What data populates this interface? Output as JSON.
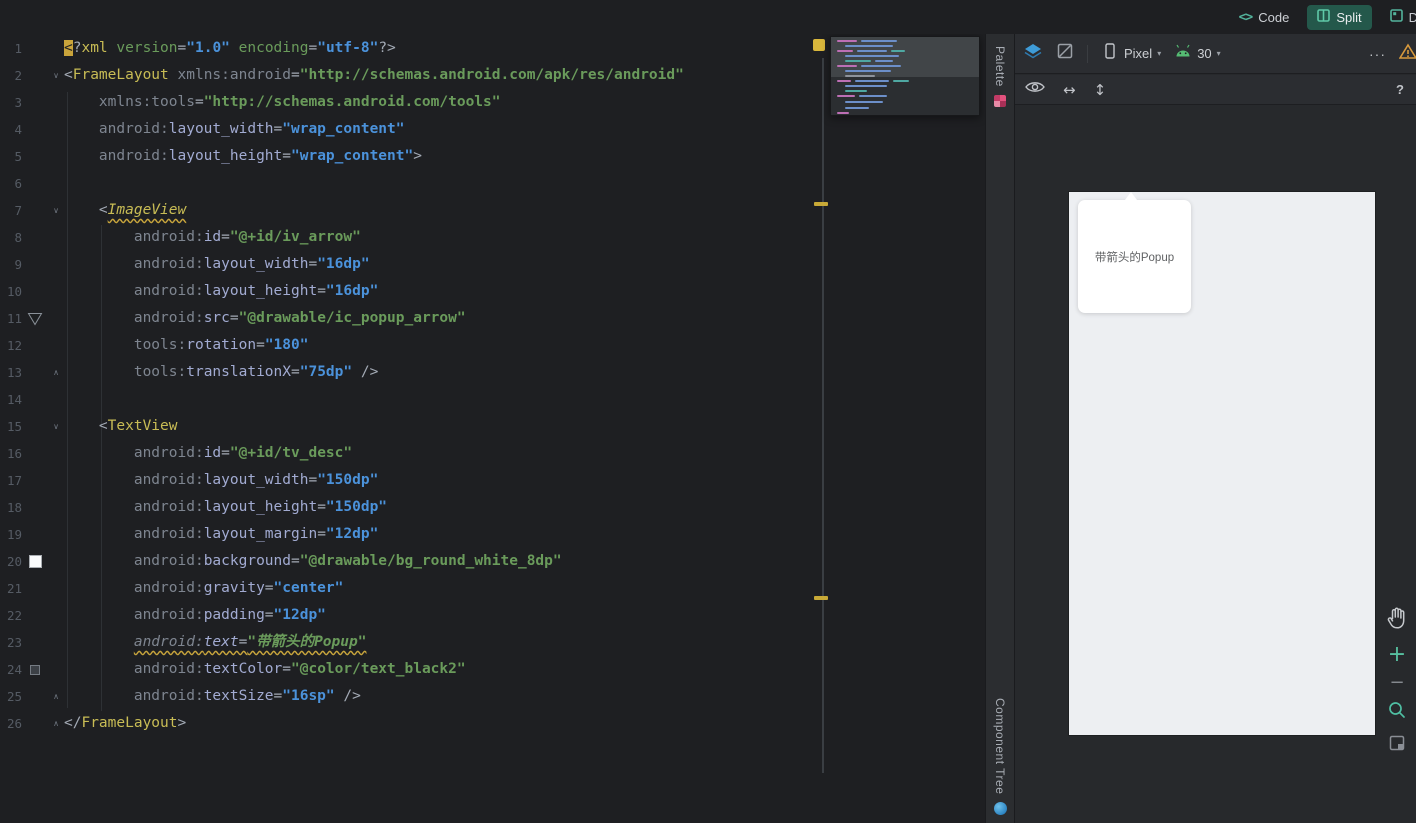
{
  "colors": {
    "editor_bg": "#1E1F22",
    "panel_bg": "#2B2D31",
    "canvas_bg": "#27292C",
    "active_tab_bg": "#24584B",
    "accent_teal": "#5FC9A8",
    "tag_yellow": "#C8BC55",
    "attr_lavender": "#A2ABD2",
    "value_blue": "#4B92DB",
    "string_green": "#6A9B5B",
    "warning_yellow": "#D9B73C",
    "device_screen_bg": "#EDEFF2",
    "popup_card_bg": "#FFFFFF",
    "palette_icon_pink": "#E4527E",
    "component_tree_icon_blue": "#3A9BD9"
  },
  "topbar": {
    "tabs": [
      {
        "id": "code",
        "label": "Code"
      },
      {
        "id": "split",
        "label": "Split",
        "active": true
      },
      {
        "id": "design",
        "label": "D"
      }
    ]
  },
  "tool_strips": {
    "palette": "Palette",
    "component_tree": "Component Tree"
  },
  "design": {
    "device_label": "Pixel",
    "api_label": "30",
    "more_label": "···",
    "help_label": "?",
    "popup_text": "带箭头的Popup"
  },
  "editor": {
    "lines": [
      {
        "n": 1,
        "t": [
          [
            "hl",
            "<"
          ],
          [
            "p",
            "?"
          ],
          [
            "tag",
            "xml"
          ],
          [
            "p",
            " "
          ],
          [
            "attrg",
            "version"
          ],
          [
            "p",
            "="
          ],
          [
            "vb",
            "\"1.0\""
          ],
          [
            "p",
            " "
          ],
          [
            "attrg",
            "encoding"
          ],
          [
            "p",
            "="
          ],
          [
            "vb",
            "\"utf-8\""
          ],
          [
            "p",
            "?>"
          ]
        ]
      },
      {
        "n": 2,
        "fold": "down",
        "t": [
          [
            "p",
            "<"
          ],
          [
            "tag",
            "FrameLayout"
          ],
          [
            "p",
            " "
          ],
          [
            "ns",
            "xmlns:android"
          ],
          [
            "p",
            "="
          ],
          [
            "vg",
            "\"http://schemas.android.com/apk/res/android\""
          ]
        ]
      },
      {
        "n": 3,
        "ind": 4,
        "t": [
          [
            "ns",
            "xmlns:tools"
          ],
          [
            "p",
            "="
          ],
          [
            "vg",
            "\"http://schemas.android.com/tools\""
          ]
        ]
      },
      {
        "n": 4,
        "ind": 4,
        "t": [
          [
            "ns",
            "android:"
          ],
          [
            "attr",
            "layout_width"
          ],
          [
            "p",
            "="
          ],
          [
            "vb",
            "\"wrap_content\""
          ]
        ]
      },
      {
        "n": 5,
        "ind": 4,
        "t": [
          [
            "ns",
            "android:"
          ],
          [
            "attr",
            "layout_height"
          ],
          [
            "p",
            "="
          ],
          [
            "vb",
            "\"wrap_content\""
          ],
          [
            "p",
            ">"
          ]
        ]
      },
      {
        "n": 6,
        "t": []
      },
      {
        "n": 7,
        "ind": 4,
        "fold": "down",
        "t": [
          [
            "p",
            "<"
          ],
          [
            "tagw",
            "ImageView"
          ]
        ]
      },
      {
        "n": 8,
        "ind": 8,
        "t": [
          [
            "ns",
            "android:"
          ],
          [
            "attr",
            "id"
          ],
          [
            "p",
            "="
          ],
          [
            "vg",
            "\"@+id/iv_arrow\""
          ]
        ]
      },
      {
        "n": 9,
        "ind": 8,
        "t": [
          [
            "ns",
            "android:"
          ],
          [
            "attr",
            "layout_width"
          ],
          [
            "p",
            "="
          ],
          [
            "vb",
            "\"16dp\""
          ]
        ]
      },
      {
        "n": 10,
        "ind": 8,
        "t": [
          [
            "ns",
            "android:"
          ],
          [
            "attr",
            "layout_height"
          ],
          [
            "p",
            "="
          ],
          [
            "vb",
            "\"16dp\""
          ]
        ]
      },
      {
        "n": 11,
        "ind": 8,
        "icon": "arrow",
        "t": [
          [
            "ns",
            "android:"
          ],
          [
            "attr",
            "src"
          ],
          [
            "p",
            "="
          ],
          [
            "vg",
            "\"@drawable/ic_popup_arrow\""
          ]
        ]
      },
      {
        "n": 12,
        "ind": 8,
        "t": [
          [
            "ns",
            "tools:"
          ],
          [
            "attr",
            "rotation"
          ],
          [
            "p",
            "="
          ],
          [
            "vb",
            "\"180\""
          ]
        ]
      },
      {
        "n": 13,
        "ind": 8,
        "fold": "up",
        "t": [
          [
            "ns",
            "tools:"
          ],
          [
            "attr",
            "translationX"
          ],
          [
            "p",
            "="
          ],
          [
            "vb",
            "\"75dp\""
          ],
          [
            "p",
            " />"
          ]
        ]
      },
      {
        "n": 14,
        "t": []
      },
      {
        "n": 15,
        "ind": 4,
        "fold": "down",
        "t": [
          [
            "p",
            "<"
          ],
          [
            "tag",
            "TextView"
          ]
        ]
      },
      {
        "n": 16,
        "ind": 8,
        "t": [
          [
            "ns",
            "android:"
          ],
          [
            "attr",
            "id"
          ],
          [
            "p",
            "="
          ],
          [
            "vg",
            "\"@+id/tv_desc\""
          ]
        ]
      },
      {
        "n": 17,
        "ind": 8,
        "t": [
          [
            "ns",
            "android:"
          ],
          [
            "attr",
            "layout_width"
          ],
          [
            "p",
            "="
          ],
          [
            "vb",
            "\"150dp\""
          ]
        ]
      },
      {
        "n": 18,
        "ind": 8,
        "t": [
          [
            "ns",
            "android:"
          ],
          [
            "attr",
            "layout_height"
          ],
          [
            "p",
            "="
          ],
          [
            "vb",
            "\"150dp\""
          ]
        ]
      },
      {
        "n": 19,
        "ind": 8,
        "t": [
          [
            "ns",
            "android:"
          ],
          [
            "attr",
            "layout_margin"
          ],
          [
            "p",
            "="
          ],
          [
            "vb",
            "\"12dp\""
          ]
        ]
      },
      {
        "n": 20,
        "ind": 8,
        "icon": "white",
        "t": [
          [
            "ns",
            "android:"
          ],
          [
            "attr",
            "background"
          ],
          [
            "p",
            "="
          ],
          [
            "vg",
            "\"@drawable/bg_round_white_8dp\""
          ]
        ]
      },
      {
        "n": 21,
        "ind": 8,
        "t": [
          [
            "ns",
            "android:"
          ],
          [
            "attr",
            "gravity"
          ],
          [
            "p",
            "="
          ],
          [
            "vb",
            "\"center\""
          ]
        ]
      },
      {
        "n": 22,
        "ind": 8,
        "t": [
          [
            "ns",
            "android:"
          ],
          [
            "attr",
            "padding"
          ],
          [
            "p",
            "="
          ],
          [
            "vb",
            "\"12dp\""
          ]
        ]
      },
      {
        "n": 23,
        "ind": 8,
        "t": [
          [
            "nsw",
            "android:"
          ],
          [
            "attrw",
            "text"
          ],
          [
            "pw",
            "="
          ],
          [
            "vgw",
            "\"带箭头的Popup\""
          ]
        ]
      },
      {
        "n": 24,
        "ind": 8,
        "icon": "dark",
        "t": [
          [
            "ns",
            "android:"
          ],
          [
            "attr",
            "textColor"
          ],
          [
            "p",
            "="
          ],
          [
            "vg",
            "\"@color/text_black2\""
          ]
        ]
      },
      {
        "n": 25,
        "ind": 8,
        "fold": "up",
        "t": [
          [
            "ns",
            "android:"
          ],
          [
            "attr",
            "textSize"
          ],
          [
            "p",
            "="
          ],
          [
            "vb",
            "\"16sp\""
          ],
          [
            "p",
            " />"
          ]
        ]
      },
      {
        "n": 26,
        "fold": "up",
        "t": [
          [
            "p",
            "</"
          ],
          [
            "tag",
            "FrameLayout"
          ],
          [
            "p",
            ">"
          ]
        ]
      }
    ],
    "lens_bars": [
      [
        6,
        3,
        20,
        "#BD6FB4"
      ],
      [
        30,
        3,
        36,
        "#6C8FC9"
      ],
      [
        14,
        8,
        48,
        "#6C8FC9"
      ],
      [
        6,
        13,
        16,
        "#BD6FB4"
      ],
      [
        26,
        13,
        30,
        "#6C8FC9"
      ],
      [
        60,
        13,
        14,
        "#4FA8A2"
      ],
      [
        14,
        18,
        54,
        "#6C8FC9"
      ],
      [
        14,
        23,
        26,
        "#4FA8A2"
      ],
      [
        44,
        23,
        18,
        "#6C8FC9"
      ],
      [
        6,
        28,
        20,
        "#BD6FB4"
      ],
      [
        30,
        28,
        40,
        "#6C8FC9"
      ],
      [
        14,
        33,
        46,
        "#6C8FC9"
      ],
      [
        14,
        38,
        30,
        "#8E939B"
      ],
      [
        6,
        43,
        14,
        "#BD6FB4"
      ],
      [
        24,
        43,
        34,
        "#6C8FC9"
      ],
      [
        62,
        43,
        16,
        "#4FA8A2"
      ],
      [
        14,
        48,
        42,
        "#6C8FC9"
      ],
      [
        14,
        53,
        22,
        "#4FA8A2"
      ],
      [
        6,
        58,
        18,
        "#BD6FB4"
      ],
      [
        28,
        58,
        28,
        "#6C8FC9"
      ],
      [
        14,
        64,
        38,
        "#6C8FC9"
      ],
      [
        14,
        70,
        24,
        "#6C8FC9"
      ],
      [
        6,
        75,
        12,
        "#BD6FB4"
      ]
    ]
  }
}
